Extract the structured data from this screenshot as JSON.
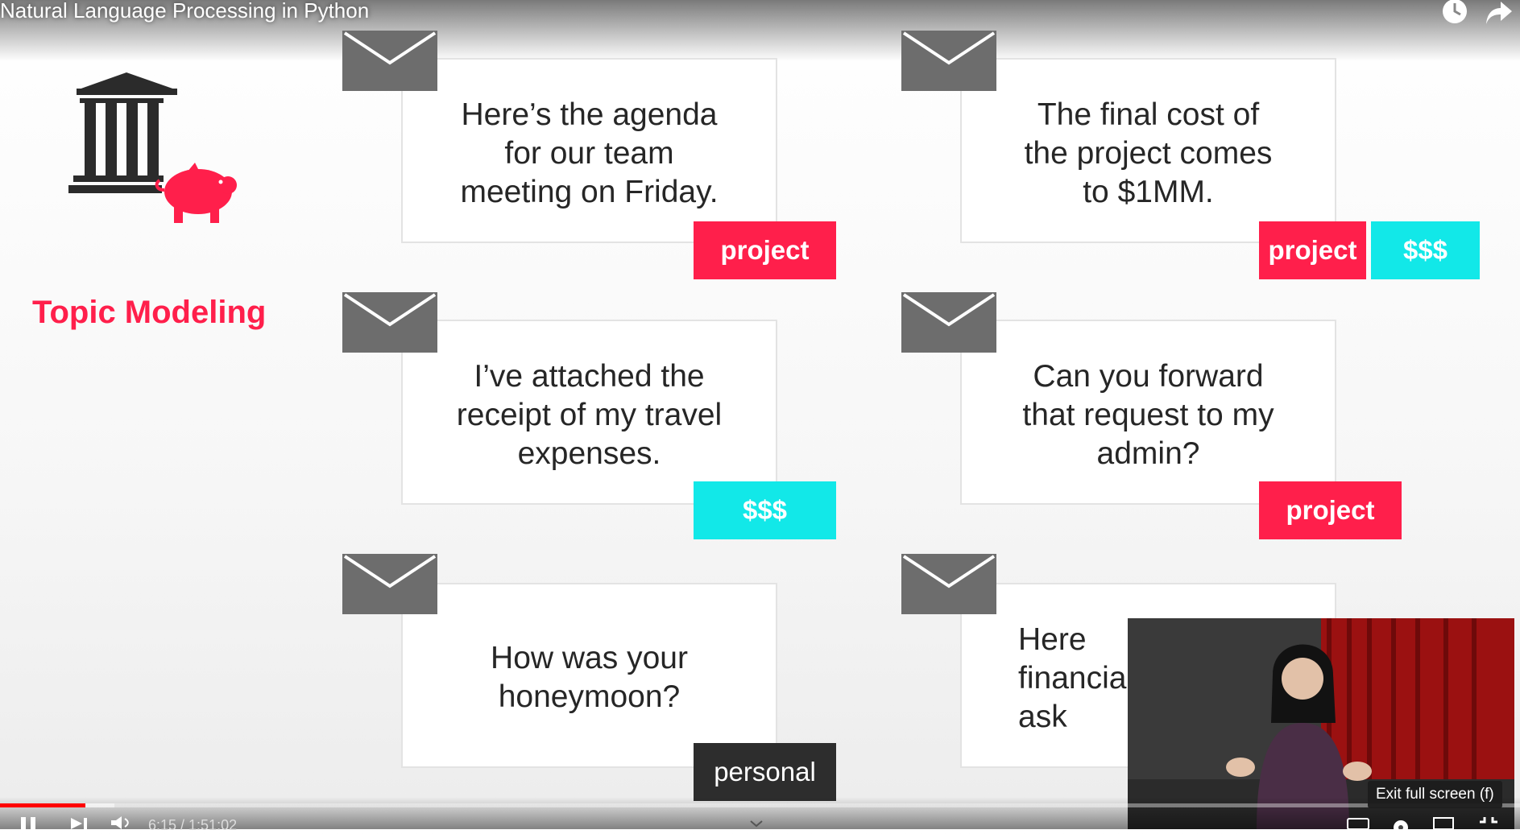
{
  "video": {
    "title": "Natural Language Processing in Python",
    "time": "6:15 / 1:51:02",
    "progress_fraction": 0.056,
    "buffered_fraction": 0.075,
    "tooltip": "Exit full screen (f)"
  },
  "slide": {
    "topic_title": "Topic Modeling",
    "cards": [
      {
        "text": "Here’s the agenda\nfor our team\nmeeting on Friday.",
        "tags": [
          {
            "label": "project",
            "color": "red"
          }
        ]
      },
      {
        "text": "The final cost of\nthe project comes\nto $1MM.",
        "tags": [
          {
            "label": "project",
            "color": "red"
          },
          {
            "label": "$$$",
            "color": "cyan"
          }
        ]
      },
      {
        "text": "I’ve attached the\nreceipt of my travel\nexpenses.",
        "tags": [
          {
            "label": "$$$",
            "color": "cyan"
          }
        ]
      },
      {
        "text": "Can you forward\nthat request to my\nadmin?",
        "tags": [
          {
            "label": "project",
            "color": "red"
          }
        ]
      },
      {
        "text": "How was your\nhoneymoon?",
        "tags": [
          {
            "label": "personal",
            "color": "dark"
          }
        ]
      },
      {
        "text": "Here\nfinancia\nask",
        "tags": []
      }
    ]
  },
  "colors": {
    "accent_red": "#ff1f4b",
    "accent_cyan": "#12e8e8",
    "envelope_gray": "#6d6d6d",
    "progress_red": "#ff0000"
  },
  "icons": [
    "clock-icon",
    "share-icon",
    "bank-icon",
    "piggy-bank-icon",
    "envelope-icon",
    "play-pause-icon",
    "next-icon",
    "volume-icon",
    "cast-icon",
    "settings-icon",
    "subtitles-icon",
    "fullscreen-icon"
  ]
}
